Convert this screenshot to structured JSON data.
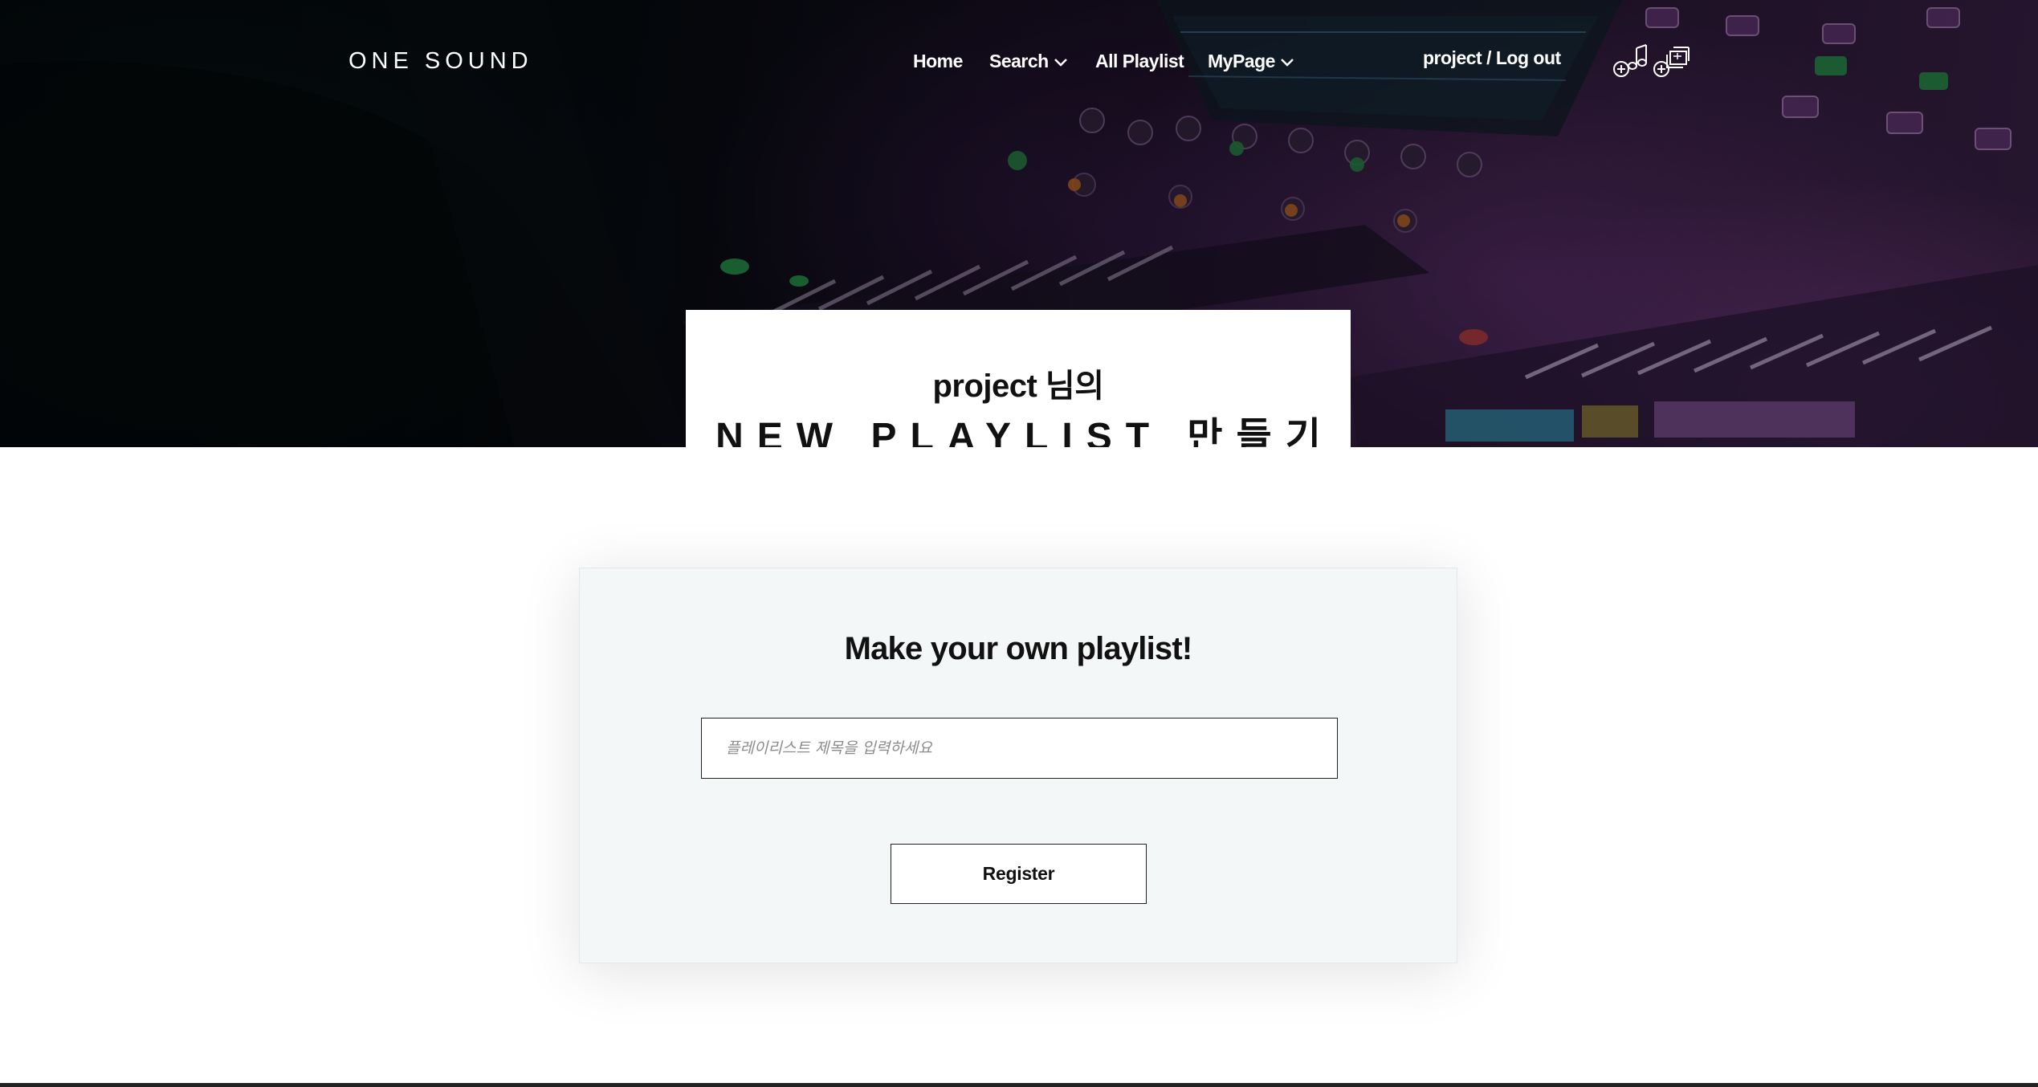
{
  "header": {
    "brand": "ONE SOUND",
    "nav": {
      "home": "Home",
      "search": "Search",
      "all_playlist": "All Playlist",
      "mypage": "MyPage"
    },
    "user_links": "project / Log out",
    "icons": [
      "add-music-icon",
      "add-playlist-icon",
      "chevron-down-icon"
    ]
  },
  "hero": {
    "greeting": "project 님의",
    "heading": "NEW PLAYLIST 만들기"
  },
  "form": {
    "title": "Make your own playlist!",
    "input_placeholder": "플레이리스트 제목을 입력하세요",
    "input_value": "",
    "submit_label": "Register"
  },
  "colors": {
    "hero_overlay": "#0a0710",
    "accent_purple": "#8a4aa0",
    "panel_bg": "#f4f7f8",
    "text_dark": "#111111",
    "white": "#ffffff"
  }
}
